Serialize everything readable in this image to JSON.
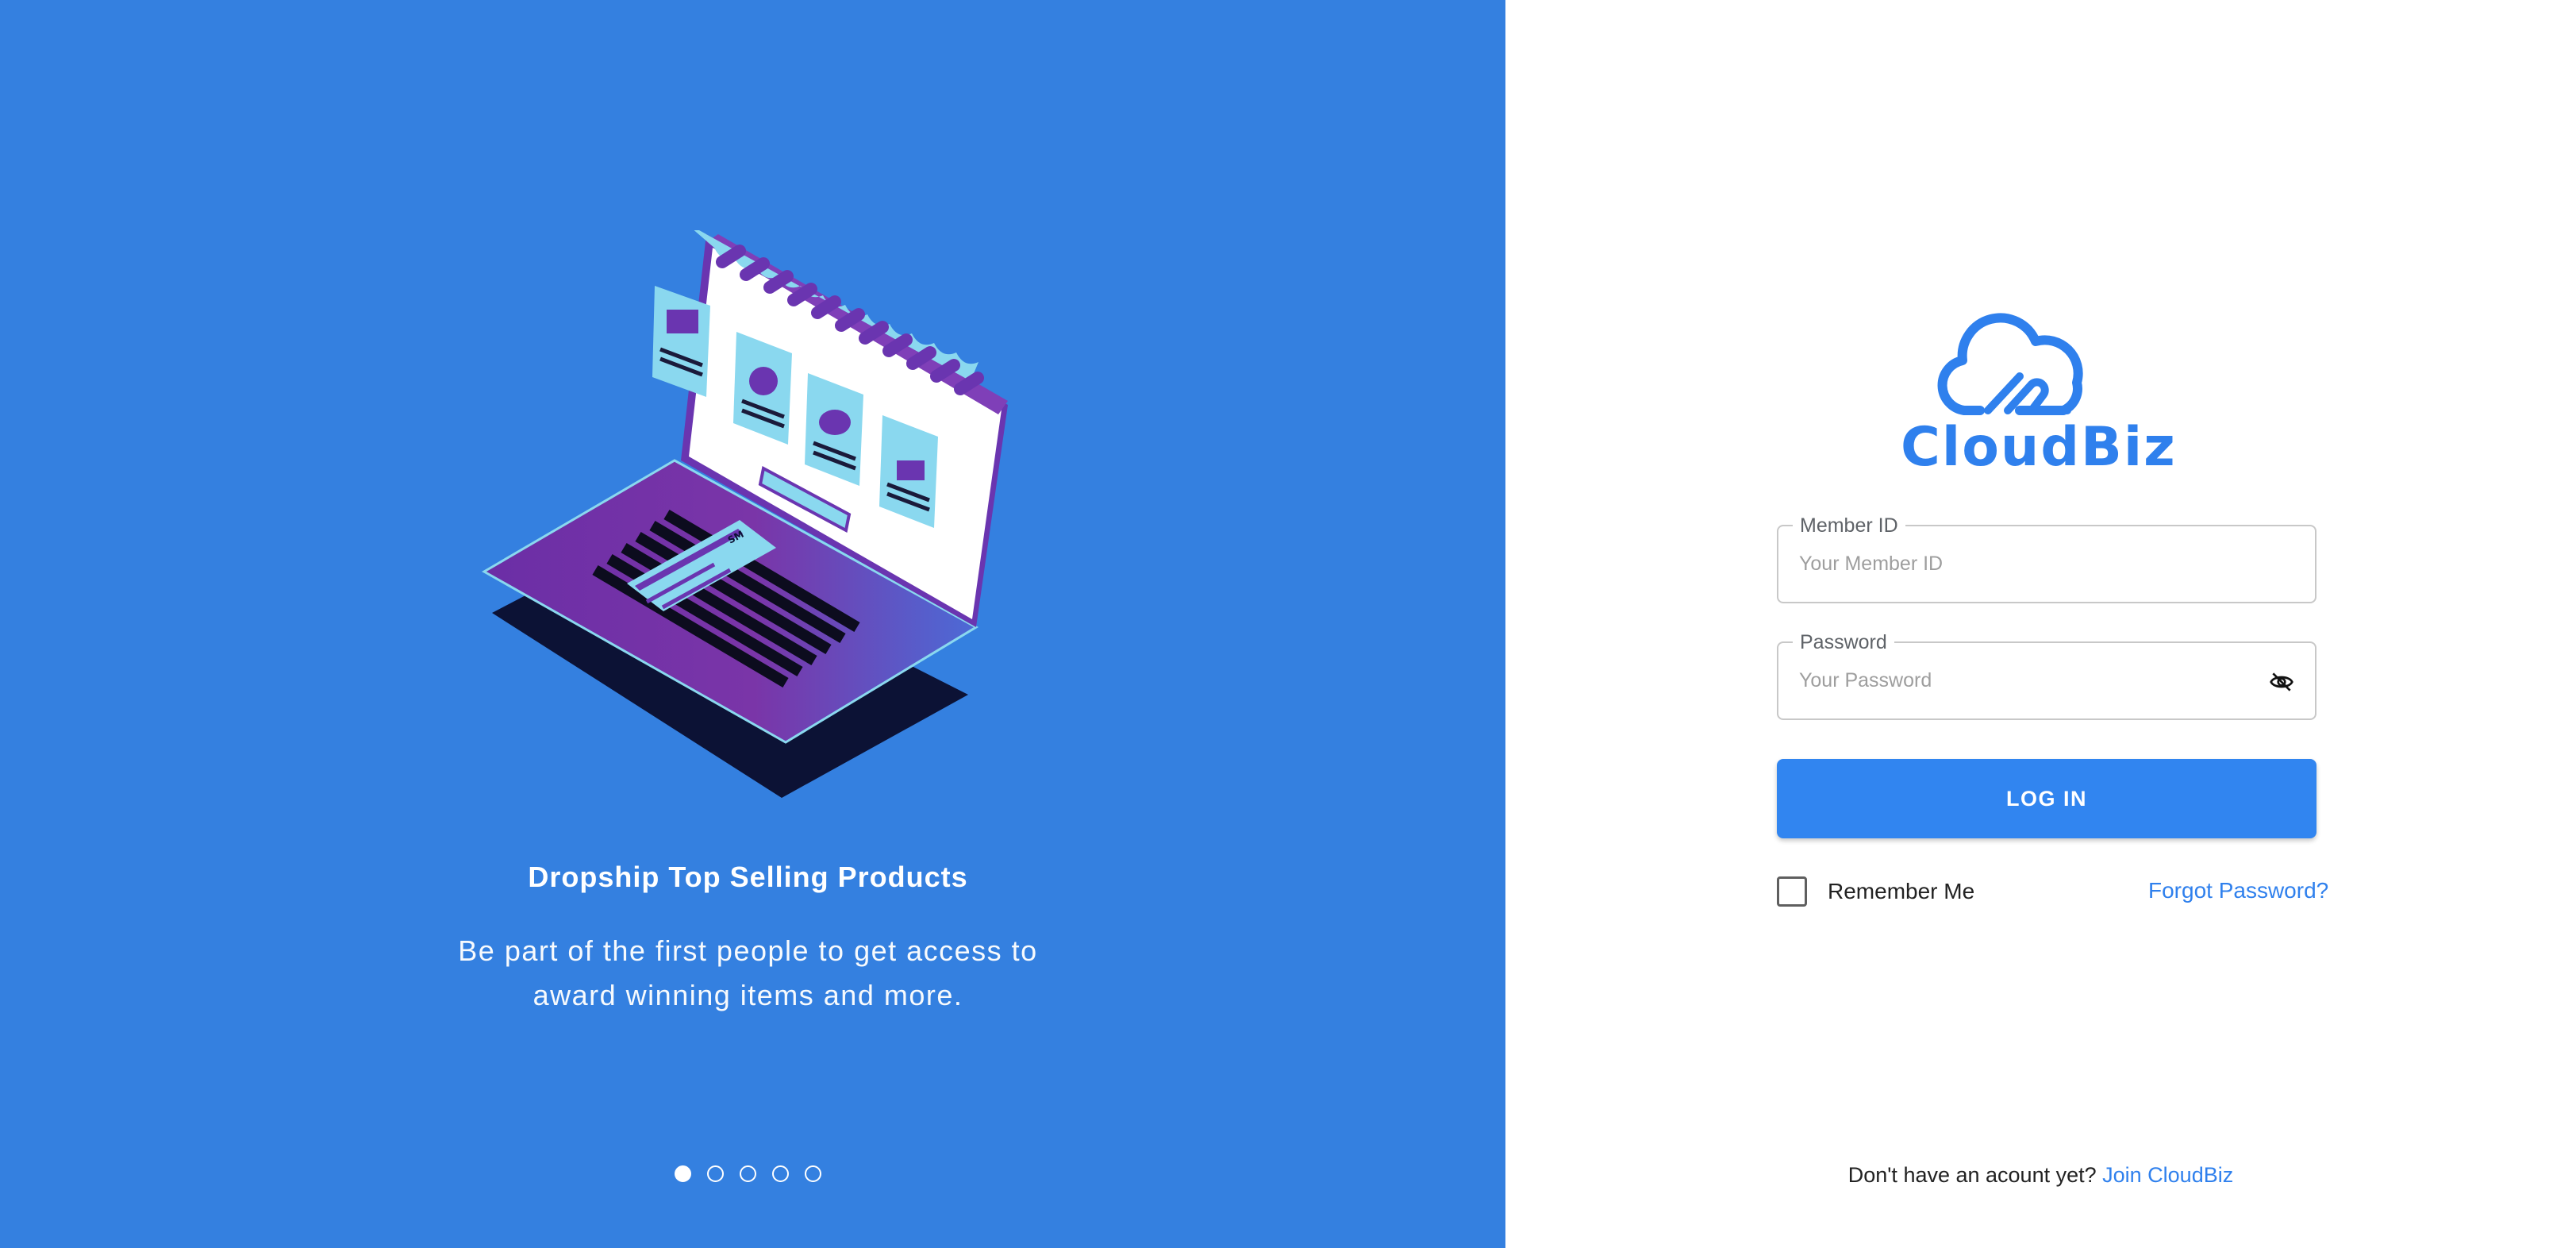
{
  "slide": {
    "title": "Dropship Top Selling Products",
    "description_line1": "Be part of the first people to get access to",
    "description_line2": "award winning items and more.",
    "dots": [
      true,
      false,
      false,
      false,
      false
    ],
    "illustration_card_label": "SM"
  },
  "brand": {
    "name": "CloudBiz",
    "accent": "#2f80ed",
    "left_bg": "#3480e0"
  },
  "form": {
    "member_id_label": "Member ID",
    "member_id_placeholder": "Your Member ID",
    "member_id_value": "",
    "password_label": "Password",
    "password_placeholder": "Your Password",
    "password_value": "",
    "password_toggle_icon": "eye-off-icon",
    "login_label": "LOG IN",
    "remember_label": "Remember Me",
    "remember_checked": false,
    "forgot_label": "Forgot Password?"
  },
  "footer": {
    "prompt": "Don't have an acount yet?",
    "join_label": "Join CloudBiz"
  }
}
